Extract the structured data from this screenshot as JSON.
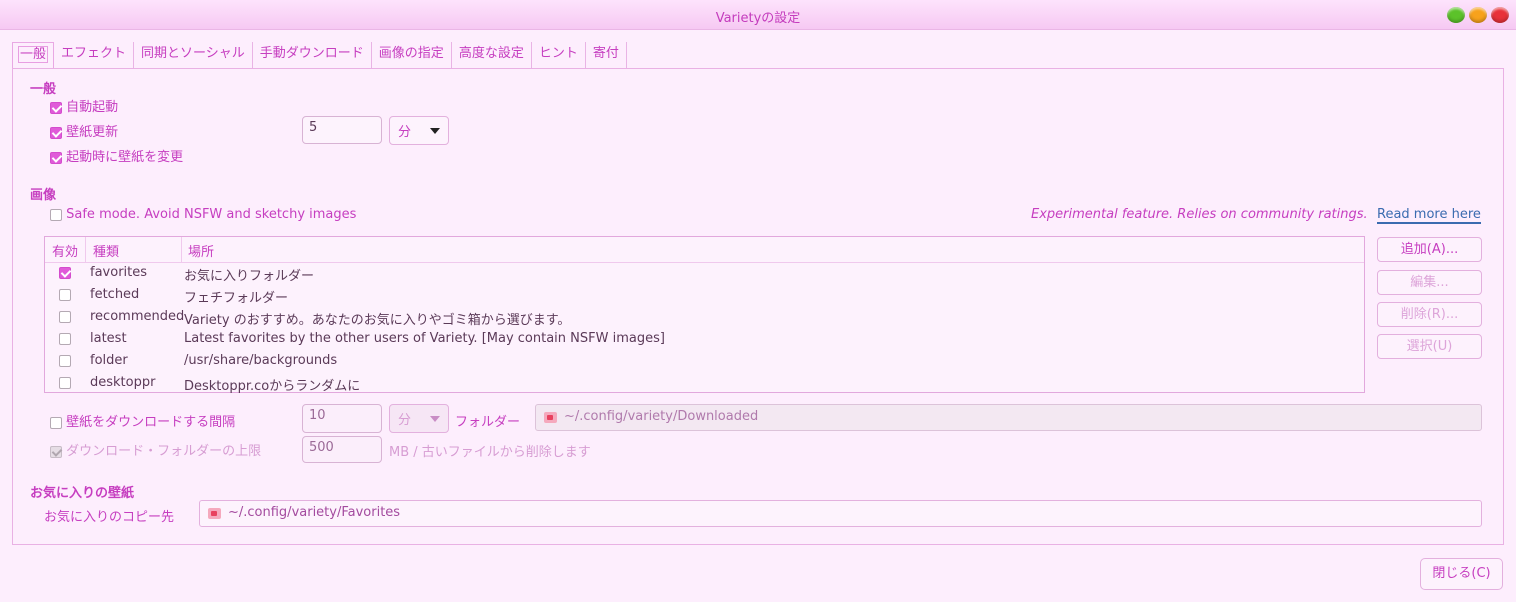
{
  "window": {
    "title": "Varietyの設定"
  },
  "tabs": [
    {
      "label": "一般"
    },
    {
      "label": "エフェクト"
    },
    {
      "label": "同期とソーシャル"
    },
    {
      "label": "手動ダウンロード"
    },
    {
      "label": "画像の指定"
    },
    {
      "label": "高度な設定"
    },
    {
      "label": "ヒント"
    },
    {
      "label": "寄付"
    }
  ],
  "general": {
    "heading": "一般",
    "autostart": {
      "label": "自動起動",
      "checked": true
    },
    "change_wallpaper": {
      "label": "壁紙更新",
      "checked": true,
      "interval": "5",
      "unit": "分"
    },
    "change_on_start": {
      "label": "起動時に壁紙を変更",
      "checked": true
    }
  },
  "images": {
    "heading": "画像",
    "safe_mode": {
      "label": "Safe mode. Avoid NSFW and sketchy images",
      "checked": false
    },
    "experimental_note": "Experimental feature. Relies on community ratings.",
    "read_more": "Read more here",
    "table": {
      "headers": {
        "enabled": "有効",
        "type": "種類",
        "location": "場所"
      },
      "rows": [
        {
          "checked": true,
          "type": "favorites",
          "location": "お気に入りフォルダー"
        },
        {
          "checked": false,
          "type": "fetched",
          "location": "フェチフォルダー"
        },
        {
          "checked": false,
          "type": "recommended",
          "location": "Variety のおすすめ。あなたのお気に入りやゴミ箱から選びます。"
        },
        {
          "checked": false,
          "type": "latest",
          "location": "Latest favorites by the other users of Variety. [May contain NSFW images]"
        },
        {
          "checked": false,
          "type": "folder",
          "location": "/usr/share/backgrounds"
        },
        {
          "checked": false,
          "type": "desktoppr",
          "location": "Desktoppr.coからランダムに"
        }
      ]
    },
    "buttons": {
      "add": "追加(A)...",
      "edit": "編集...",
      "remove": "削除(R)...",
      "select": "選択(U)"
    },
    "download_interval": {
      "label": "壁紙をダウンロードする間隔",
      "checked": false,
      "value": "10",
      "unit": "分",
      "folder_label": "フォルダー",
      "folder_path": "~/.config/variety/Downloaded"
    },
    "download_limit": {
      "label": "ダウンロード・フォルダーの上限",
      "checked": true,
      "value": "500",
      "suffix": "MB / 古いファイルから削除します"
    }
  },
  "favorites": {
    "heading": "お気に入りの壁紙",
    "copy_label": "お気に入りのコピー先",
    "copy_path": "~/.config/variety/Favorites"
  },
  "footer": {
    "close_label": "閉じる(C)"
  },
  "colors": {
    "accent": "#c63ec0",
    "background": "#fdeefd",
    "link": "#3a6bb0"
  }
}
